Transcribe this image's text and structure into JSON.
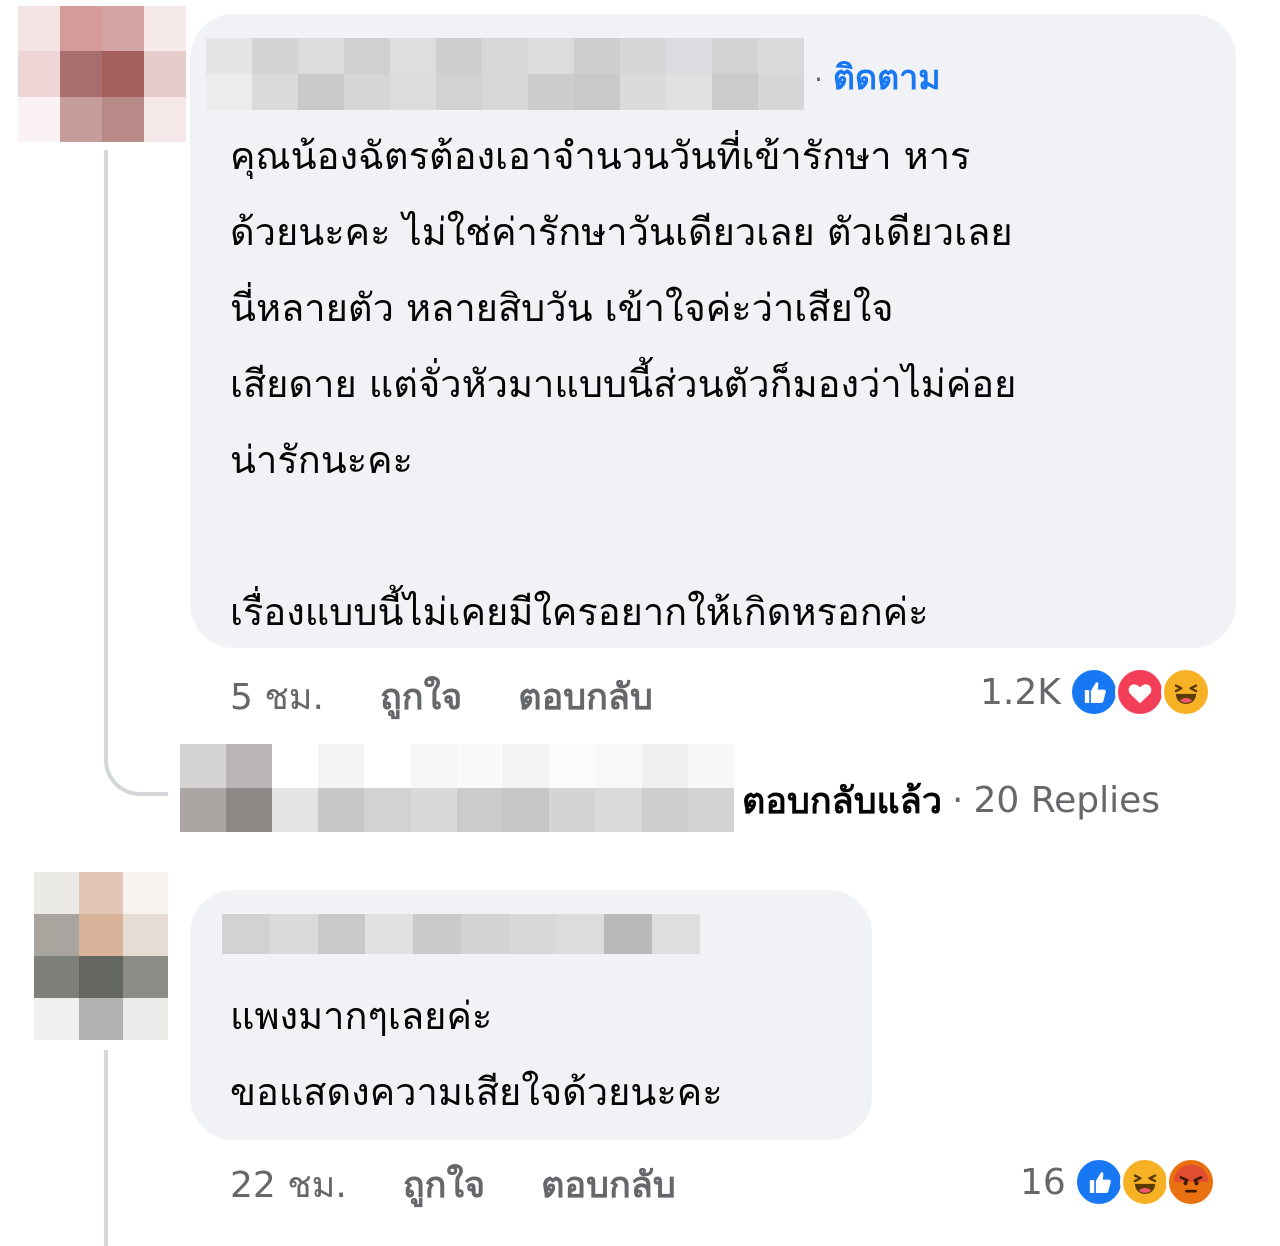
{
  "thread": {
    "comment1": {
      "follow_label": "ติดตาม",
      "follow_separator": "·",
      "text": "คุณน้องฉัตรต้องเอาจำนวนวันที่เข้ารักษา หาร\nด้วยนะคะ ไม่ใช่ค่ารักษาวันเดียวเลย ตัวเดียวเลย\nนี่หลายตัว หลายสิบวัน เข้าใจค่ะว่าเสียใจ\nเสียดาย แต่จั่วหัวมาแบบนี้ส่วนตัวก็มองว่าไม่ค่อย\nน่ารักนะคะ\n\nเรื่องแบบนี้ไม่เคยมีใครอยากให้เกิดหรอกค่ะ",
      "time": "5 ชม.",
      "like_label": "ถูกใจ",
      "reply_label": "ตอบกลับ",
      "reaction_count": "1.2K",
      "reactions": [
        "like-icon",
        "love-icon",
        "haha-icon"
      ],
      "replies": {
        "replied_label": "ตอบกลับแล้ว",
        "separator": "·",
        "count_label": "20 Replies"
      }
    },
    "comment2": {
      "text": "แพงมากๆเลยค่ะ\nขอแสดงความเสียใจด้วยนะคะ",
      "time": "22 ชม.",
      "like_label": "ถูกใจ",
      "reply_label": "ตอบกลับ",
      "reaction_count": "16",
      "reactions": [
        "like-icon",
        "haha-icon",
        "angry-icon"
      ]
    }
  },
  "colors": {
    "bubble": "#f0f2f5",
    "link_blue": "#1877f2",
    "meta_gray": "#65676b",
    "thread_line": "#d3d6db",
    "like": "#1877f2",
    "love": "#f33e58",
    "haha": "#f7b125",
    "angry": "#e9710f"
  }
}
